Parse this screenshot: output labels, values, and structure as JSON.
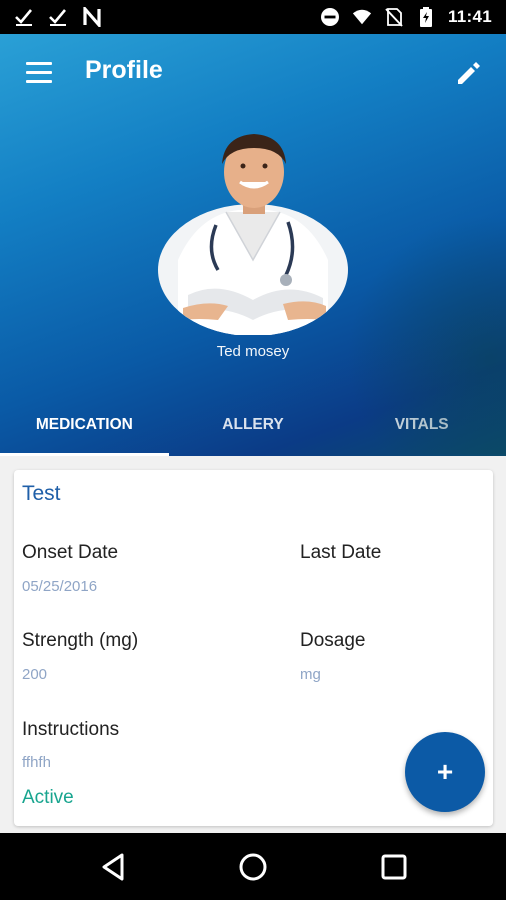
{
  "status_bar": {
    "time": "11:41",
    "left_icons": [
      "check-icon",
      "check-icon",
      "n-icon"
    ],
    "right_icons": [
      "do-not-disturb-icon",
      "wifi-icon",
      "no-sim-icon",
      "battery-icon"
    ]
  },
  "header": {
    "title": "Profile",
    "user_name": "Ted mosey",
    "gradient_colors": [
      "#2aa0d6",
      "#0a5aa6",
      "#0b3b86"
    ]
  },
  "tabs": [
    {
      "label": "MEDICATION",
      "active": true
    },
    {
      "label": "ALLERY",
      "active": false
    },
    {
      "label": "VITALS",
      "active": false
    }
  ],
  "medication": {
    "name": "Test",
    "onset_date_label": "Onset Date",
    "onset_date_value": "05/25/2016",
    "last_date_label": "Last Date",
    "last_date_value": "",
    "strength_label": "Strength (mg)",
    "strength_value": "200",
    "dosage_label": "Dosage",
    "dosage_value": "mg",
    "instructions_label": "Instructions",
    "instructions_value": "ffhfh",
    "status": "Active"
  },
  "fab": {
    "icon": "plus-icon",
    "label": "+"
  },
  "colors": {
    "accent": "#0c5aa6",
    "title_blue": "#1f5fa8",
    "value_muted": "#8fa5c6",
    "status_green": "#18a58f"
  }
}
